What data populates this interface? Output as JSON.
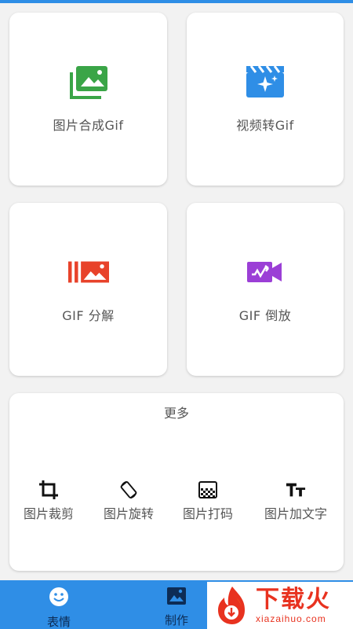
{
  "colors": {
    "accent": "#2f8ee6",
    "card_bg": "#ffffff",
    "icon_green": "#3aa547",
    "icon_blue": "#2f8ee6",
    "icon_red": "#e8422a",
    "icon_purple": "#9b3fd6",
    "watermark_red": "#e8321f"
  },
  "cards": [
    {
      "label": "图片合成Gif",
      "icon": "photo-stack-icon"
    },
    {
      "label": "视频转Gif",
      "icon": "clapperboard-sparkle-icon"
    },
    {
      "label": "GIF 分解",
      "icon": "frames-split-icon"
    },
    {
      "label": "GIF 倒放",
      "icon": "video-camera-reverse-icon"
    }
  ],
  "more": {
    "title": "更多",
    "tools": [
      {
        "label": "图片裁剪",
        "icon": "crop-icon"
      },
      {
        "label": "图片旋转",
        "icon": "rotate-icon"
      },
      {
        "label": "图片打码",
        "icon": "mosaic-icon"
      },
      {
        "label": "图片加文字",
        "icon": "text-icon"
      }
    ]
  },
  "nav": [
    {
      "label": "表情",
      "icon": "smiley-icon"
    },
    {
      "label": "制作",
      "icon": "image-icon"
    }
  ],
  "watermark": {
    "name": "下载火",
    "domain": "xiazaihuo.com"
  }
}
